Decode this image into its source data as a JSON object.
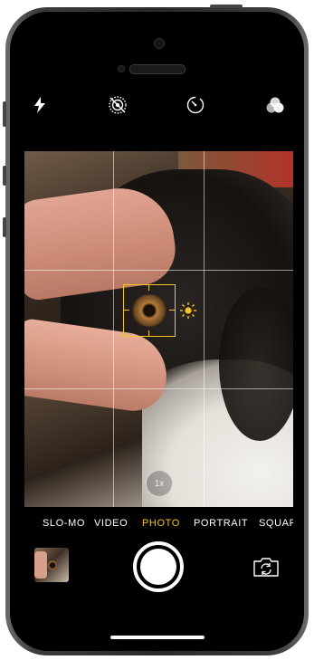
{
  "toolbar": {
    "flash_icon": "flash-icon",
    "live_photo_icon": "live-photo-off-icon",
    "timer_icon": "timer-icon",
    "filters_icon": "filters-icon"
  },
  "viewfinder": {
    "zoom_label": "1x",
    "exposure_icon": "sun-icon",
    "focus_color": "#f3c623"
  },
  "modes": {
    "items": [
      "SLO-MO",
      "VIDEO",
      "PHOTO",
      "PORTRAIT",
      "SQUARE"
    ],
    "active": "PHOTO"
  },
  "controls": {
    "thumbnail_icon": "last-photo-thumbnail",
    "shutter_icon": "shutter-button",
    "flip_icon": "camera-flip-icon"
  },
  "colors": {
    "accent": "#f3c623",
    "background": "#000000",
    "foreground": "#ffffff"
  }
}
